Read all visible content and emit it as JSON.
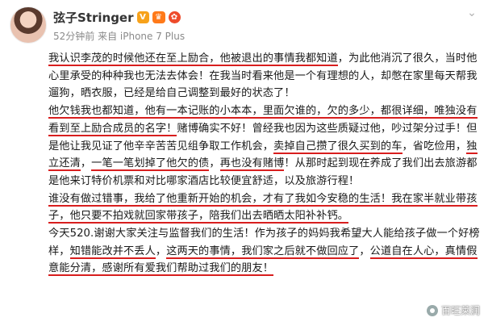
{
  "post": {
    "username": "弦子Stringer",
    "meta": "52分钟前 来自 iPhone 7 Plus",
    "badges": {
      "v": "V",
      "vip": "♛",
      "medal": "✿"
    }
  },
  "paragraphs": [
    {
      "segments": [
        {
          "text": "我认识李茂的时候他还在至上励合，他被退出的事情我都知道",
          "u": true
        },
        {
          "text": "，为此他消沉了很久，当时他心里承受的种种我也无法去体会！在我当时看来他是一个有理想的人，却憋在家里每天帮我遛狗，晒衣服，已经是给自己调整到最好的状态了！",
          "u": false
        }
      ]
    },
    {
      "segments": [
        {
          "text": "  他欠钱我也都知道，他有一本记账的小本本，里面欠谁的，欠的多少，都很详细，唯独没有看到至上励合成员的名字！",
          "u": true
        },
        {
          "text": "赌博确实不好！曾经我也因为这些质疑过他，吵过架分过手！但是他让我见证了他辛辛苦苦见组争取工作机会，",
          "u": false
        },
        {
          "text": "卖掉自己攒了很久买到的车",
          "u": true
        },
        {
          "text": "，省吃俭用，",
          "u": false
        },
        {
          "text": "独立还清",
          "u": true
        },
        {
          "text": "，",
          "u": false
        },
        {
          "text": "一笔一笔划掉了他欠的债",
          "u": true
        },
        {
          "text": "，",
          "u": false
        },
        {
          "text": "再也没有赌博",
          "u": true
        },
        {
          "text": "！从那时起到现在养成了我们出去旅游都是他来订特价机票和对比哪家酒店比较便宜舒适，以及旅游行程！",
          "u": false
        }
      ]
    },
    {
      "segments": [
        {
          "text": "  谁没有做过错事，我给了他重新开始的机会，才有了我如今安稳的生活！我在家半就业带孩子，他只要不拍戏就回家带孩子，陪我们出去晒晒太阳补补钙。",
          "u": true
        }
      ]
    },
    {
      "segments": [
        {
          "text": "今天520.谢谢大家关注与监督我们的生活！作为孩子的妈妈我希望大人能给孩子做一个好榜样，",
          "u": false
        },
        {
          "text": "知错能改并不丢人",
          "u": true
        },
        {
          "text": "，",
          "u": false
        },
        {
          "text": "这两天的事情，我们家之后就不做回应了",
          "u": true
        },
        {
          "text": "，",
          "u": false
        },
        {
          "text": "公道自在人心，真情假意能分清，感谢所有爱我们帮助过我们的朋友！",
          "u": true
        }
      ]
    }
  ],
  "watermark": "百旺莱润"
}
